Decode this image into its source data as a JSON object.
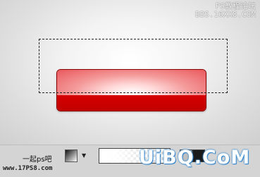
{
  "watermark": {
    "line1": "PS教程论坛",
    "line2": "BBS.16XX8.COM"
  },
  "toolbar": {
    "mode_label": "一起ps吧",
    "dropdown_icon": "triangle-down",
    "site_text": "www.17PS8.com"
  },
  "brand": {
    "text": "UiBQ.CoM"
  },
  "colors": {
    "button_top": "#f49a9a",
    "button_bottom": "#d70000",
    "canvas_bg": "#dedede"
  }
}
